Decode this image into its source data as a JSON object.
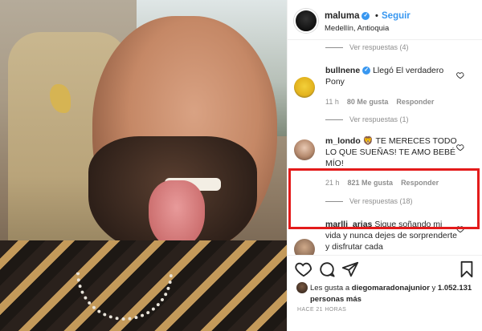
{
  "header": {
    "username": "maluma",
    "follow_label": "Seguir",
    "location": "Medellín, Antioquia",
    "separator": "•"
  },
  "thread": {
    "replies_top": "Ver respuestas (4)",
    "comment1": {
      "user": "bullnene",
      "text": "Llegó El verdadero Pony",
      "time": "11 h",
      "likes": "80 Me gusta",
      "reply": "Responder"
    },
    "replies_mid": "Ver respuestas (1)",
    "comment2": {
      "user": "m_londo",
      "emojis": "🦁",
      "text": "TE MERECES TODO LO QUE SUEÑAS! TE AMO BEBÉ MÍO!",
      "time": "21 h",
      "likes": "821 Me gusta",
      "reply": "Responder"
    },
    "replies_bottom": "Ver respuestas (18)",
    "comment3": {
      "user": "marlli_arias",
      "text": "Sigue soñando mi vida y nunca dejes de sorprenderte y disfrutar cada"
    }
  },
  "likes_line": {
    "prefix": "Les gusta a",
    "user": "diegomaradonajunior",
    "connector": "y",
    "count": "1.052.131 personas más"
  },
  "timestamp": "HACE 21 HORAS",
  "colors": {
    "accent": "#3897f0",
    "highlight": "#e31b1b",
    "muted": "#8e8e8e"
  }
}
